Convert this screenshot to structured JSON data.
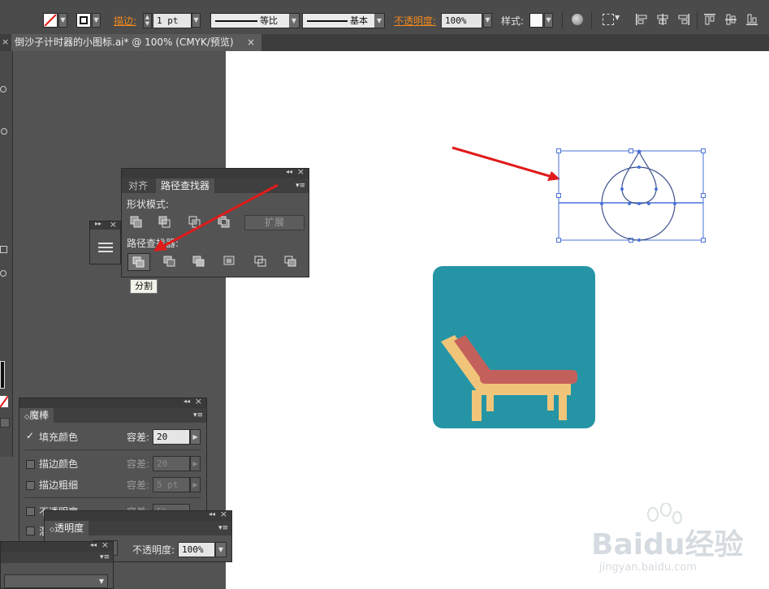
{
  "control_bar": {
    "stroke_label": "描边:",
    "stroke_value": "1 pt",
    "profile_label": "等比",
    "brush_label": "基本",
    "opacity_label": "不透明度:",
    "opacity_value": "100%",
    "style_label": "样式:",
    "accent": "#f28a1d"
  },
  "document": {
    "tab_title": "倒沙子计时器的小图标.ai* @ 100% (CMYK/预览)",
    "close_glyph": "×"
  },
  "pathfinder_panel": {
    "tabs": [
      "对齐",
      "路径查找器"
    ],
    "active_tab": "路径查找器",
    "shape_modes_label": "形状模式:",
    "expand_button": "扩展",
    "pathfinders_label": "路径查找器:",
    "tooltip": "分割"
  },
  "magic_wand_panel": {
    "title": "魔棒",
    "rows": [
      {
        "label": "填充颜色",
        "checked": true,
        "tol_label": "容差:",
        "tol_value": "20",
        "enabled": true
      },
      {
        "label": "描边颜色",
        "checked": false,
        "tol_label": "容差:",
        "tol_value": "20",
        "enabled": false
      },
      {
        "label": "描边粗细",
        "checked": false,
        "tol_label": "容差:",
        "tol_value": "5 pt",
        "enabled": false
      },
      {
        "label": "不透明度",
        "checked": false,
        "tol_label": "容差:",
        "tol_value": "5%",
        "enabled": false
      },
      {
        "label": "混",
        "checked": false
      }
    ]
  },
  "transparency_panel": {
    "title": "透明度",
    "opacity_label": "不透明度:",
    "opacity_value": "100%"
  },
  "artwork": {
    "icon_bg": "#2595a6",
    "chair_back": "#c4605b",
    "chair_frame": "#f0c57a",
    "selection_color": "#4a72d6",
    "arrow_color": "#e01b1b"
  },
  "watermark": {
    "brand": "Baidu经验",
    "url": "jingyan.baidu.com"
  }
}
